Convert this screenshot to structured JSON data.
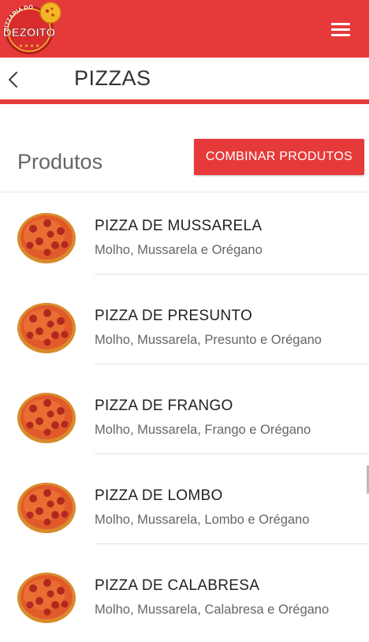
{
  "brand": {
    "logo_text_top": "PIZZARIA DO",
    "logo_text_main": "DEZOITO"
  },
  "header": {
    "title": "PIZZAS"
  },
  "section": {
    "title": "Produtos",
    "combine_label": "COMBINAR PRODUTOS"
  },
  "products": [
    {
      "name": "PIZZA DE MUSSARELA",
      "description": "Molho, Mussarela e Orégano"
    },
    {
      "name": "PIZZA DE PRESUNTO",
      "description": "Molho, Mussarela, Presunto e Orégano"
    },
    {
      "name": "PIZZA DE FRANGO",
      "description": "Molho, Mussarela, Frango e Orégano"
    },
    {
      "name": "PIZZA DE LOMBO",
      "description": "Molho, Mussarela, Lombo e Orégano"
    },
    {
      "name": "PIZZA DE CALABRESA",
      "description": "Molho, Mussarela, Calabresa e Orégano"
    }
  ],
  "colors": {
    "accent": "#e63a3a",
    "title_text": "#333333",
    "muted_text": "#666666"
  },
  "icons": {
    "menu": "hamburger-menu-icon",
    "back": "chevron-left-icon",
    "product": "pizza-icon"
  }
}
